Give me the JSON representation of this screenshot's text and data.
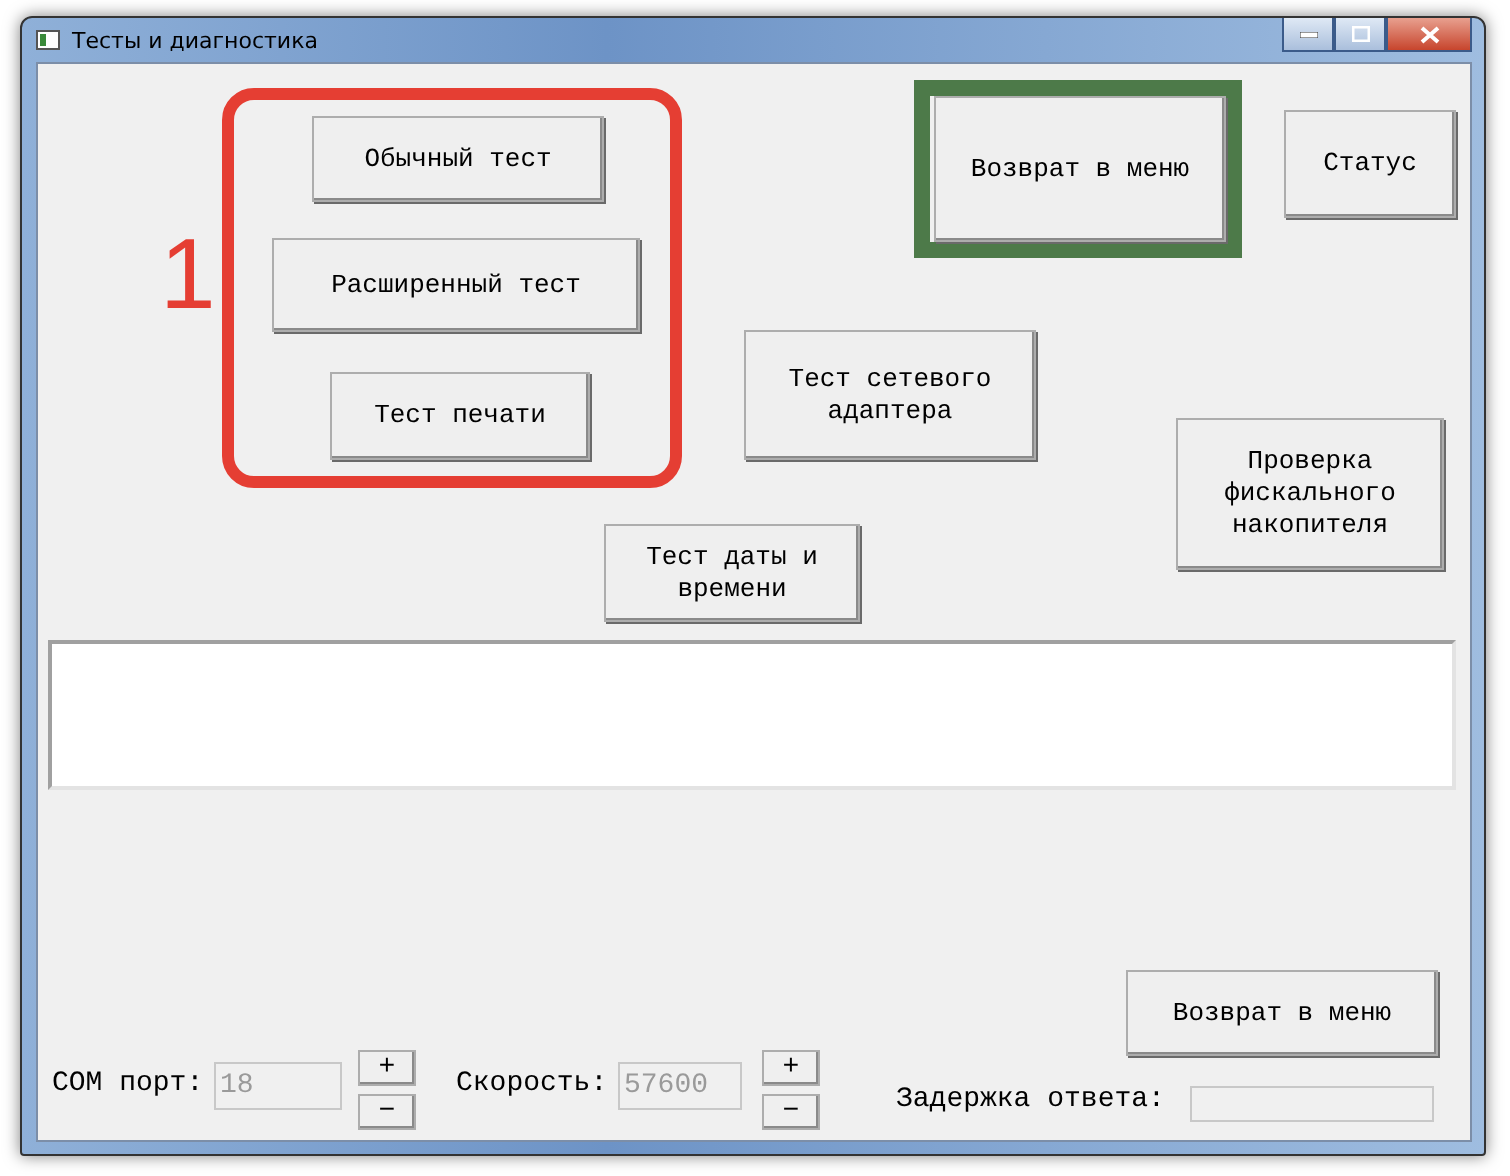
{
  "window": {
    "title": "Тесты и диагностика"
  },
  "test_buttons": [
    {
      "label": "Обычный тест"
    },
    {
      "label": "Расширенный тест"
    },
    {
      "label": "Тест печати"
    }
  ],
  "annotation": {
    "marker": "1"
  },
  "menu_button": {
    "label": "Возврат в меню",
    "highlighted": true
  },
  "buttons": [
    {
      "label": "Статус"
    },
    {
      "label": "Тест сетевого адаптера"
    },
    {
      "label": "Проверка фискального накопителя"
    },
    {
      "label": "Тест даты и времени"
    }
  ],
  "bottom_button": {
    "label": "Возврат в меню"
  },
  "com_port": {
    "label": "COM порт:",
    "value": "18",
    "disabled": true,
    "plus": "+",
    "minus": "−"
  },
  "speed": {
    "label": "Скорость:",
    "value": "57600",
    "disabled": true,
    "plus": "+",
    "minus": "−"
  },
  "delay": {
    "label": "Задержка ответа:",
    "disabled": true
  }
}
